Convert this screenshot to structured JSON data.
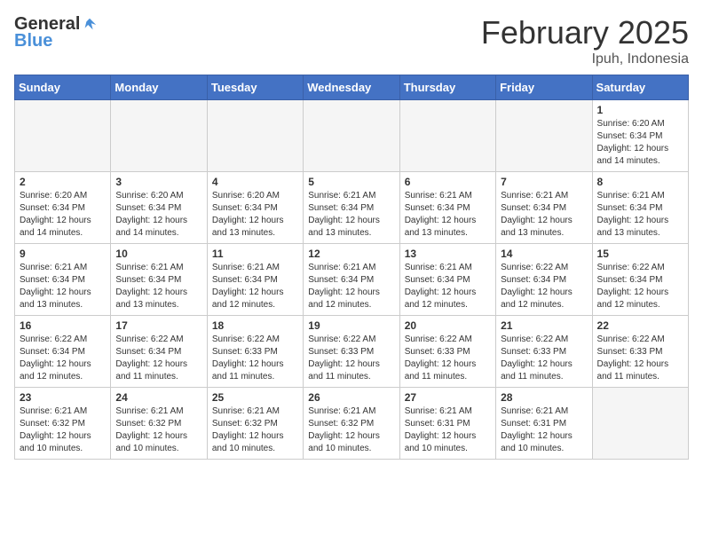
{
  "header": {
    "logo_general": "General",
    "logo_blue": "Blue",
    "month_title": "February 2025",
    "location": "Ipuh, Indonesia"
  },
  "weekdays": [
    "Sunday",
    "Monday",
    "Tuesday",
    "Wednesday",
    "Thursday",
    "Friday",
    "Saturday"
  ],
  "weeks": [
    [
      {
        "day": "",
        "info": ""
      },
      {
        "day": "",
        "info": ""
      },
      {
        "day": "",
        "info": ""
      },
      {
        "day": "",
        "info": ""
      },
      {
        "day": "",
        "info": ""
      },
      {
        "day": "",
        "info": ""
      },
      {
        "day": "1",
        "info": "Sunrise: 6:20 AM\nSunset: 6:34 PM\nDaylight: 12 hours\nand 14 minutes."
      }
    ],
    [
      {
        "day": "2",
        "info": "Sunrise: 6:20 AM\nSunset: 6:34 PM\nDaylight: 12 hours\nand 14 minutes."
      },
      {
        "day": "3",
        "info": "Sunrise: 6:20 AM\nSunset: 6:34 PM\nDaylight: 12 hours\nand 14 minutes."
      },
      {
        "day": "4",
        "info": "Sunrise: 6:20 AM\nSunset: 6:34 PM\nDaylight: 12 hours\nand 13 minutes."
      },
      {
        "day": "5",
        "info": "Sunrise: 6:21 AM\nSunset: 6:34 PM\nDaylight: 12 hours\nand 13 minutes."
      },
      {
        "day": "6",
        "info": "Sunrise: 6:21 AM\nSunset: 6:34 PM\nDaylight: 12 hours\nand 13 minutes."
      },
      {
        "day": "7",
        "info": "Sunrise: 6:21 AM\nSunset: 6:34 PM\nDaylight: 12 hours\nand 13 minutes."
      },
      {
        "day": "8",
        "info": "Sunrise: 6:21 AM\nSunset: 6:34 PM\nDaylight: 12 hours\nand 13 minutes."
      }
    ],
    [
      {
        "day": "9",
        "info": "Sunrise: 6:21 AM\nSunset: 6:34 PM\nDaylight: 12 hours\nand 13 minutes."
      },
      {
        "day": "10",
        "info": "Sunrise: 6:21 AM\nSunset: 6:34 PM\nDaylight: 12 hours\nand 13 minutes."
      },
      {
        "day": "11",
        "info": "Sunrise: 6:21 AM\nSunset: 6:34 PM\nDaylight: 12 hours\nand 12 minutes."
      },
      {
        "day": "12",
        "info": "Sunrise: 6:21 AM\nSunset: 6:34 PM\nDaylight: 12 hours\nand 12 minutes."
      },
      {
        "day": "13",
        "info": "Sunrise: 6:21 AM\nSunset: 6:34 PM\nDaylight: 12 hours\nand 12 minutes."
      },
      {
        "day": "14",
        "info": "Sunrise: 6:22 AM\nSunset: 6:34 PM\nDaylight: 12 hours\nand 12 minutes."
      },
      {
        "day": "15",
        "info": "Sunrise: 6:22 AM\nSunset: 6:34 PM\nDaylight: 12 hours\nand 12 minutes."
      }
    ],
    [
      {
        "day": "16",
        "info": "Sunrise: 6:22 AM\nSunset: 6:34 PM\nDaylight: 12 hours\nand 12 minutes."
      },
      {
        "day": "17",
        "info": "Sunrise: 6:22 AM\nSunset: 6:34 PM\nDaylight: 12 hours\nand 11 minutes."
      },
      {
        "day": "18",
        "info": "Sunrise: 6:22 AM\nSunset: 6:33 PM\nDaylight: 12 hours\nand 11 minutes."
      },
      {
        "day": "19",
        "info": "Sunrise: 6:22 AM\nSunset: 6:33 PM\nDaylight: 12 hours\nand 11 minutes."
      },
      {
        "day": "20",
        "info": "Sunrise: 6:22 AM\nSunset: 6:33 PM\nDaylight: 12 hours\nand 11 minutes."
      },
      {
        "day": "21",
        "info": "Sunrise: 6:22 AM\nSunset: 6:33 PM\nDaylight: 12 hours\nand 11 minutes."
      },
      {
        "day": "22",
        "info": "Sunrise: 6:22 AM\nSunset: 6:33 PM\nDaylight: 12 hours\nand 11 minutes."
      }
    ],
    [
      {
        "day": "23",
        "info": "Sunrise: 6:21 AM\nSunset: 6:32 PM\nDaylight: 12 hours\nand 10 minutes."
      },
      {
        "day": "24",
        "info": "Sunrise: 6:21 AM\nSunset: 6:32 PM\nDaylight: 12 hours\nand 10 minutes."
      },
      {
        "day": "25",
        "info": "Sunrise: 6:21 AM\nSunset: 6:32 PM\nDaylight: 12 hours\nand 10 minutes."
      },
      {
        "day": "26",
        "info": "Sunrise: 6:21 AM\nSunset: 6:32 PM\nDaylight: 12 hours\nand 10 minutes."
      },
      {
        "day": "27",
        "info": "Sunrise: 6:21 AM\nSunset: 6:31 PM\nDaylight: 12 hours\nand 10 minutes."
      },
      {
        "day": "28",
        "info": "Sunrise: 6:21 AM\nSunset: 6:31 PM\nDaylight: 12 hours\nand 10 minutes."
      },
      {
        "day": "",
        "info": ""
      }
    ]
  ]
}
